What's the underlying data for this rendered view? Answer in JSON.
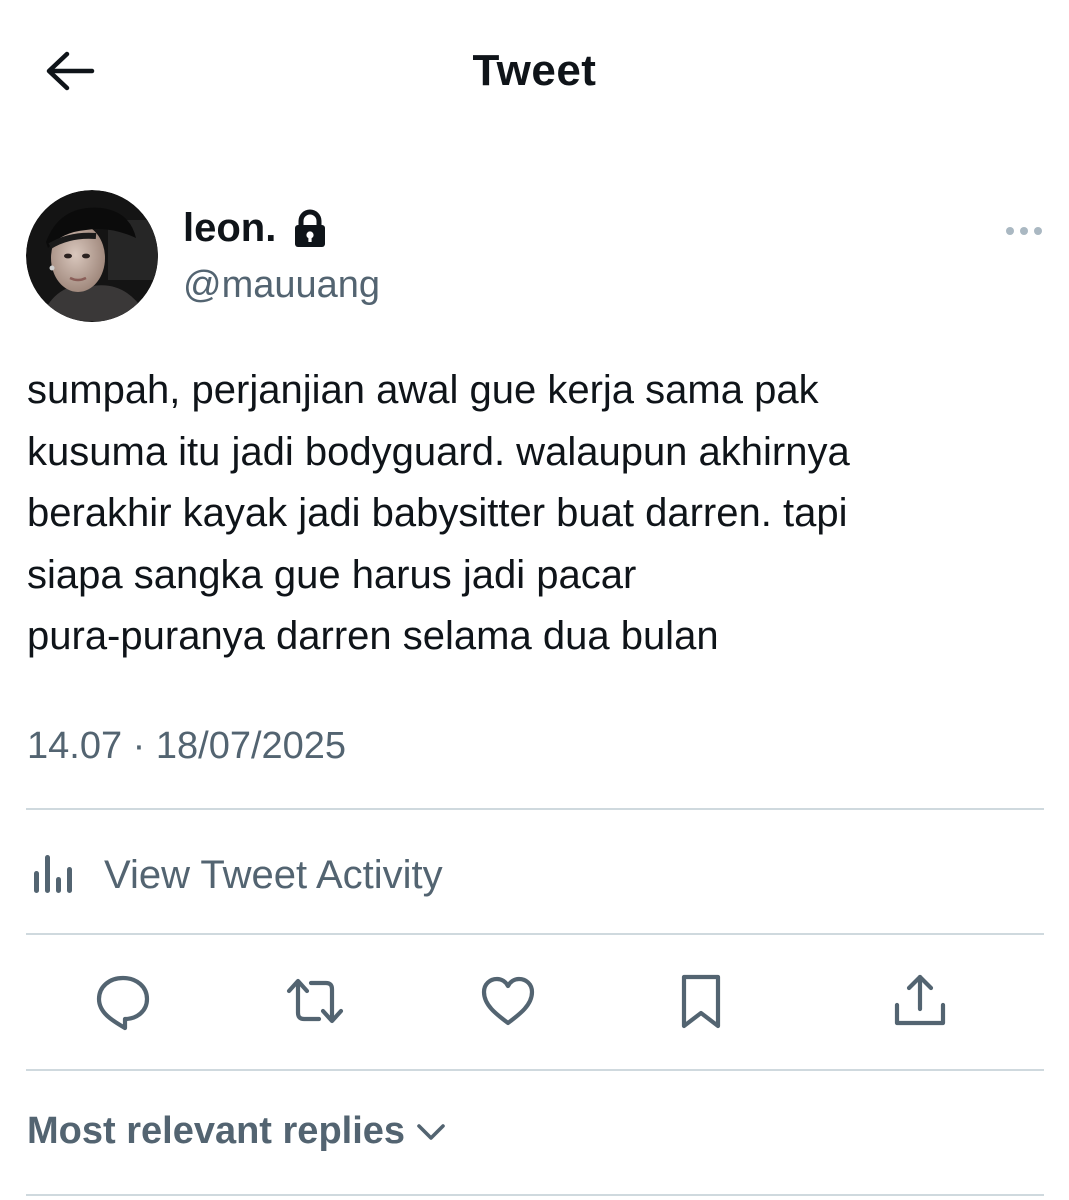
{
  "header": {
    "title": "Tweet",
    "back_icon": "arrow-left-icon"
  },
  "author": {
    "display_name": "leon.",
    "handle": "@mauuang",
    "protected_icon": "lock-icon",
    "avatar_icon": "avatar-photo",
    "more_icon": "more-horizontal-icon"
  },
  "tweet": {
    "text": "sumpah, perjanjian awal gue kerja sama pak\nkusuma itu jadi bodyguard. walaupun akhirnya\nberakhir kayak jadi babysitter buat darren. tapi\nsiapa sangka gue harus jadi pacar\npura-puranya darren selama dua bulan",
    "timestamp": "14.07 · 18/07/2025"
  },
  "activity": {
    "label": "View Tweet Activity",
    "icon": "bar-chart-icon"
  },
  "actions": [
    {
      "name": "reply",
      "icon": "reply-bubble-icon"
    },
    {
      "name": "retweet",
      "icon": "retweet-icon"
    },
    {
      "name": "like",
      "icon": "heart-icon"
    },
    {
      "name": "bookmark",
      "icon": "bookmark-icon"
    },
    {
      "name": "share",
      "icon": "share-icon"
    }
  ],
  "replies": {
    "sort_label": "Most relevant replies",
    "chevron_icon": "chevron-down-icon"
  },
  "colors": {
    "text_primary": "#0f1419",
    "text_secondary": "#536471",
    "divider": "#cfd9de",
    "background": "#ffffff"
  }
}
